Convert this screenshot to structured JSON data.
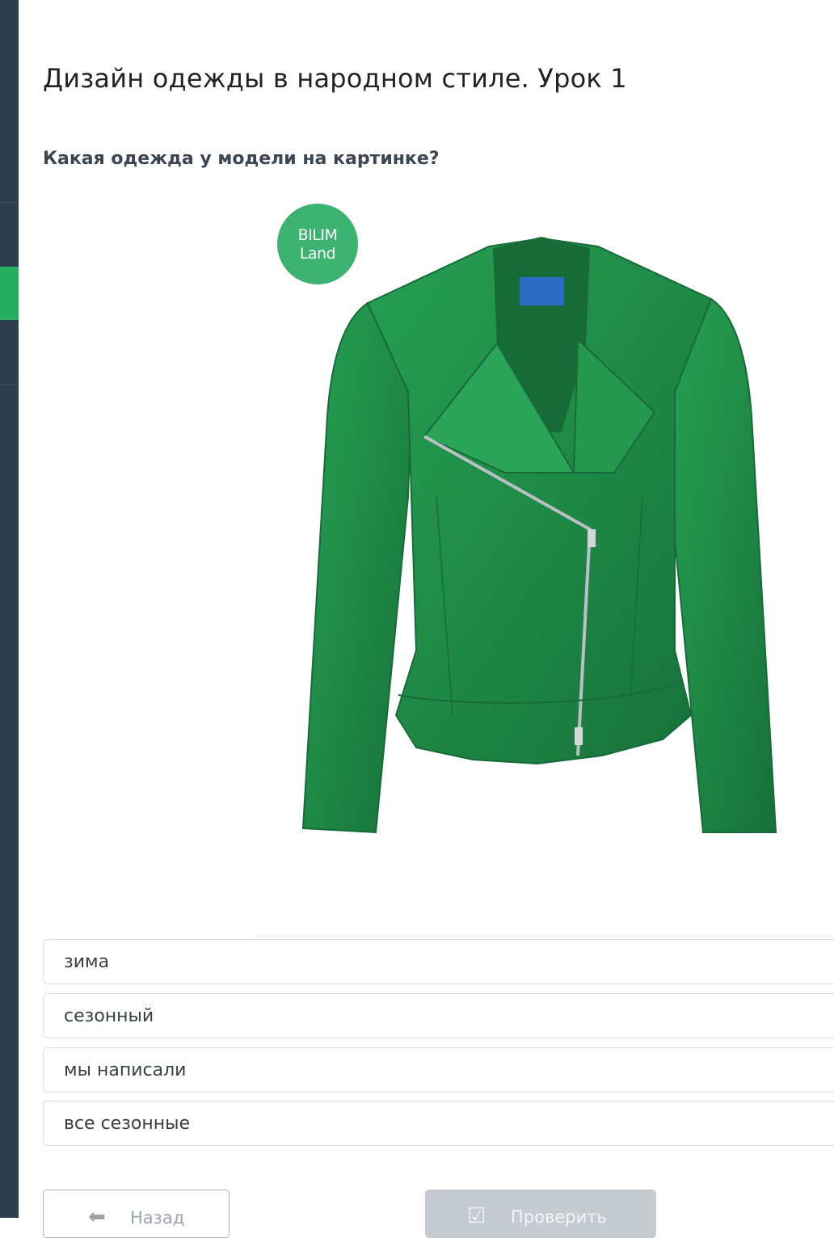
{
  "lesson": {
    "title": "Дизайн одежды в народном стиле. Урок 1",
    "question": "Какая одежда у модели на картинке?"
  },
  "image": {
    "subject": "green-leather-jacket",
    "logo_line1": "BILIM",
    "logo_line2": "Land",
    "colors": {
      "jacket": "#1f8a46",
      "logo": "#3cb371",
      "label": "#2a6cc4"
    }
  },
  "answers": [
    {
      "label": "зима"
    },
    {
      "label": "сезонный"
    },
    {
      "label": "мы написали"
    },
    {
      "label": "все сезонные"
    }
  ],
  "buttons": {
    "back_label": "Назад",
    "check_label": "Проверить"
  },
  "colors": {
    "sidebar": "#2e3e4e",
    "sidebar_active": "#27ae60",
    "check_disabled": "#c6cbd0"
  }
}
